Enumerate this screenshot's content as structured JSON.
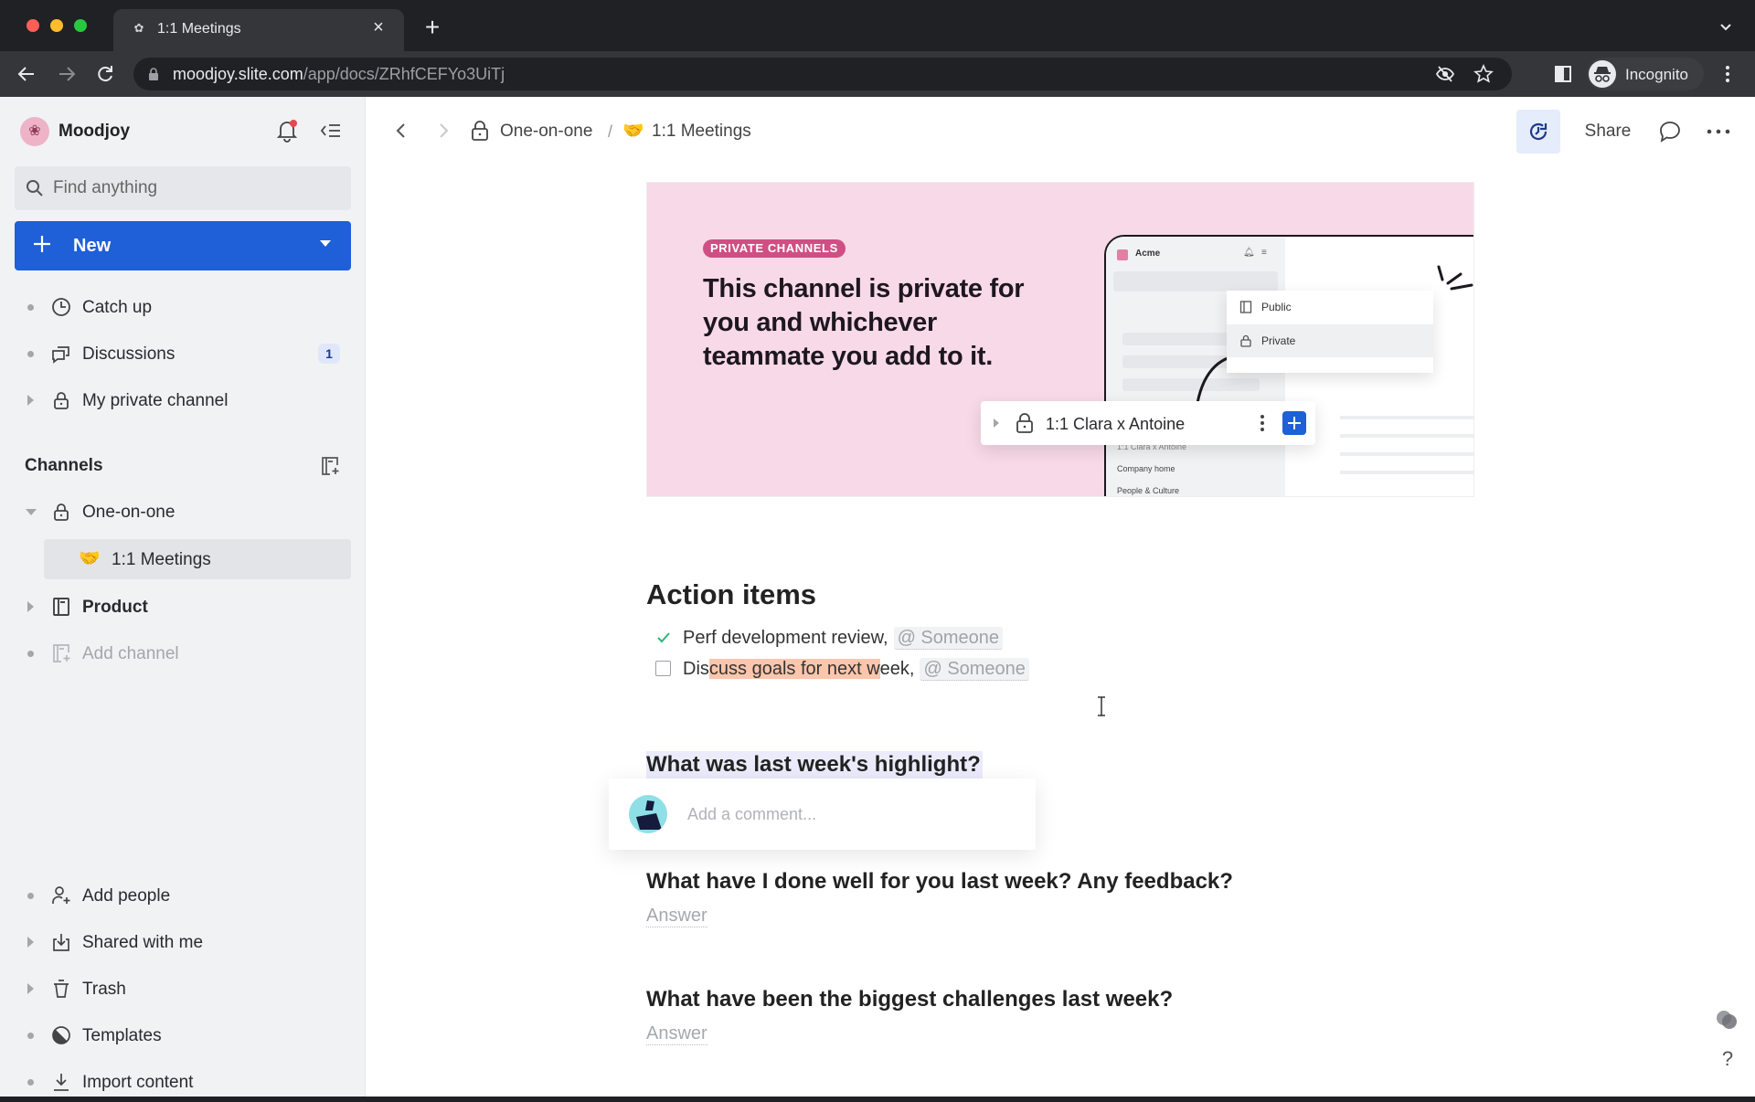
{
  "browser": {
    "tab_title": "1:1 Meetings",
    "url_domain": "moodjoy.slite.com",
    "url_path": "/app/docs/ZRhfCEFYo3UiTj",
    "profile_label": "Incognito"
  },
  "sidebar": {
    "workspace_name": "Moodjoy",
    "search_placeholder": "Find anything",
    "new_label": "New",
    "top_items": [
      {
        "label": "Catch up",
        "icon": "clock-icon"
      },
      {
        "label": "Discussions",
        "icon": "chat-bubbles-icon",
        "badge": "1"
      },
      {
        "label": "My private channel",
        "icon": "lock-icon"
      }
    ],
    "channels_title": "Channels",
    "channels": [
      {
        "label": "One-on-one",
        "icon": "lock-icon",
        "expanded": true
      },
      {
        "label": "1:1 Meetings",
        "emoji": "🤝",
        "active": true
      },
      {
        "label": "Product",
        "icon": "book-icon"
      },
      {
        "label": "Add channel",
        "icon": "add-channel-icon"
      }
    ],
    "bottom_items": [
      {
        "label": "Add people",
        "icon": "add-user-icon"
      },
      {
        "label": "Shared with me",
        "icon": "inbox-download-icon"
      },
      {
        "label": "Trash",
        "icon": "trash-icon"
      },
      {
        "label": "Templates",
        "icon": "templates-icon"
      },
      {
        "label": "Import content",
        "icon": "import-icon"
      }
    ]
  },
  "header": {
    "breadcrumb": [
      {
        "label": "One-on-one",
        "icon": "lock-icon"
      },
      {
        "label": "1:1 Meetings",
        "emoji": "🤝"
      }
    ],
    "separator": "/",
    "share_label": "Share"
  },
  "banner": {
    "tag": "PRIVATE CHANNELS",
    "headline": "This channel is private for you and whichever teammate you add to it.",
    "mock": {
      "workspace": "Acme",
      "menu_options": [
        "Public",
        "Private"
      ],
      "highlighted_channel": "1:1 Clara x Antoine",
      "list": [
        "1:1 Clara x Antoine",
        "Company home",
        "People & Culture"
      ]
    }
  },
  "doc": {
    "action_items_title": "Action items",
    "action_items": [
      {
        "text_before": "Perf development review,",
        "highlight": "",
        "text_after": "",
        "mention": "@ Someone",
        "done": true
      },
      {
        "text_before": "Dis",
        "highlight": "cuss goals for next w",
        "text_after": "eek,",
        "mention": "@ Someone",
        "done": false
      }
    ],
    "questions": [
      {
        "question": "What was last week's highlight?",
        "selected": true
      },
      {
        "question": "What have I done well for you last week? Any feedback?",
        "answer_placeholder": "Answer"
      },
      {
        "question": "What have been the biggest challenges last week?",
        "answer_placeholder": "Answer"
      }
    ],
    "comment_placeholder": "Add a comment..."
  },
  "colors": {
    "accent": "#1f5fd8",
    "banner_bg": "#f8d9e7",
    "tag_bg": "#cf4f84",
    "check_green": "#2bb673",
    "text_highlight": "#fbc6ac"
  }
}
